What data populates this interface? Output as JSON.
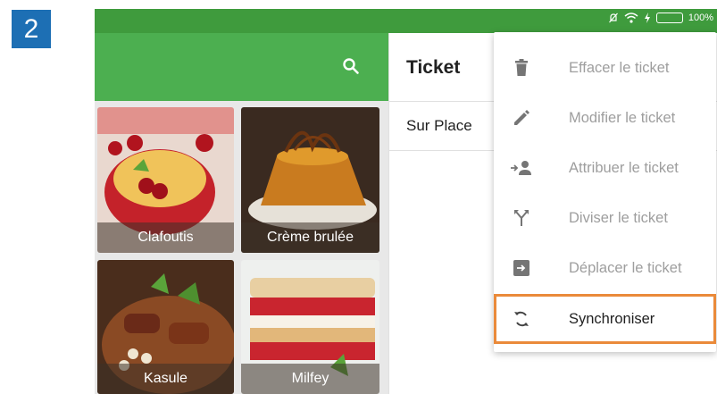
{
  "step": {
    "number": "2"
  },
  "status_bar": {
    "battery": "100%"
  },
  "colors": {
    "accent": "#4caf50",
    "status_bar": "#3f9b3d",
    "highlight": "#ea8a3a",
    "badge": "#1d6fb4"
  },
  "products": [
    {
      "name": "Clafoutis"
    },
    {
      "name": "Crème brulée"
    },
    {
      "name": "Kasule"
    },
    {
      "name": "Milfey"
    }
  ],
  "ticket": {
    "title": "Ticket",
    "order_type": "Sur Place"
  },
  "menu": {
    "items": [
      {
        "label": "Effacer le ticket",
        "icon": "trash-icon"
      },
      {
        "label": "Modifier le ticket",
        "icon": "pencil-icon"
      },
      {
        "label": "Attribuer le ticket",
        "icon": "assign-user-icon"
      },
      {
        "label": "Diviser le ticket",
        "icon": "split-icon"
      },
      {
        "label": "Déplacer le ticket",
        "icon": "move-icon"
      },
      {
        "label": "Synchroniser",
        "icon": "sync-icon"
      }
    ]
  }
}
